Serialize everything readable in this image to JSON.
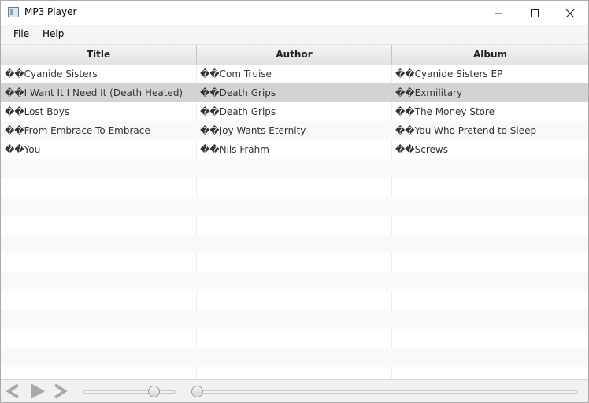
{
  "window": {
    "title": "MP3 Player",
    "icon": "app-window-icon",
    "controls": [
      "minimize-icon",
      "maximize-icon",
      "close-icon"
    ]
  },
  "menu": {
    "items": [
      {
        "label": "File"
      },
      {
        "label": "Help"
      }
    ]
  },
  "table": {
    "columns": [
      "Title",
      "Author",
      "Album"
    ],
    "rows": [
      {
        "title": "��Cyanide Sisters",
        "author": "��Com Truise",
        "album": "��Cyanide Sisters EP"
      },
      {
        "title": "��I Want It I Need It (Death Heated)",
        "author": "��Death Grips",
        "album": "��Exmilitary"
      },
      {
        "title": "��Lost Boys",
        "author": "��Death Grips",
        "album": "��The Money Store"
      },
      {
        "title": "��From Embrace To Embrace",
        "author": "��Joy Wants Eternity",
        "album": "��You Who Pretend to Sleep"
      },
      {
        "title": "��You",
        "author": "��Nils Frahm",
        "album": "��Screws"
      }
    ],
    "selected_row": 1
  },
  "controls": {
    "icons": [
      "previous-icon",
      "play-icon",
      "next-icon"
    ],
    "volume_level": 0.8,
    "progress_level": 0.0,
    "colors": {
      "icon": "#a9a9a9",
      "selected_row": "#d3d3d3"
    }
  }
}
